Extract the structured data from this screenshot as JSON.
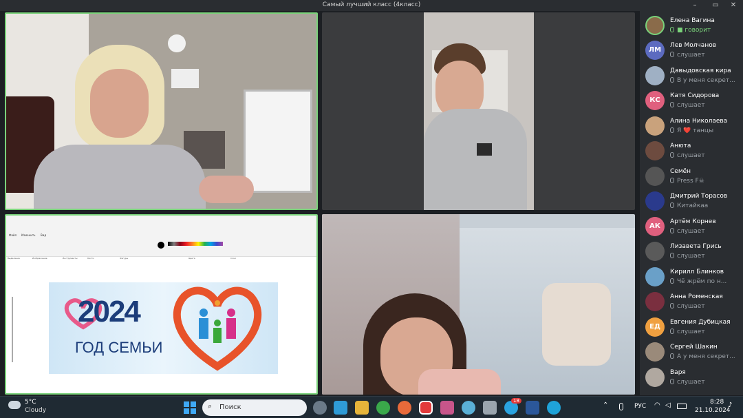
{
  "window": {
    "title": "Самый лучший класс (4класс)",
    "minimize": "–",
    "maximize": "▭",
    "close": "✕"
  },
  "paint": {
    "menu_file": "Файл",
    "menu_edit": "Изменить",
    "menu_view": "Вид",
    "year": "2024",
    "slogan": "ГОД СЕМЬИ",
    "groups": [
      "Выделение",
      "Изображение",
      "Инструменты",
      "Кисти",
      "Фигуры",
      "Цвета",
      "Слои"
    ]
  },
  "participants": [
    {
      "name": "Елена Вагина",
      "status": "говорит",
      "initials": "",
      "color": "#8a6b4a",
      "speaking": true
    },
    {
      "name": "Лев Молчанов",
      "status": "слушает",
      "initials": "ЛМ",
      "color": "#5c6bc0"
    },
    {
      "name": "Давыдовская кира",
      "status": "В у меня секрет...",
      "initials": "",
      "color": "#9fb0c4"
    },
    {
      "name": "Катя Сидорова",
      "status": "слушает",
      "initials": "КС",
      "color": "#e0607e"
    },
    {
      "name": "Алина Николаева",
      "status": "Я ❤️ танцы",
      "initials": "",
      "color": "#c9a27c"
    },
    {
      "name": "Анюта",
      "status": "слушает",
      "initials": "",
      "color": "#6d4b3f"
    },
    {
      "name": "Семён",
      "status": "Press F☠",
      "initials": "",
      "color": "#555"
    },
    {
      "name": "Дмитрий Торасов",
      "status": "Китайкаа",
      "initials": "",
      "color": "#2a3a8c"
    },
    {
      "name": "Артём Корнев",
      "status": "слушает",
      "initials": "АК",
      "color": "#e0607e"
    },
    {
      "name": "Лизавета Грись",
      "status": "слушает",
      "initials": "",
      "color": "#5a5a5a"
    },
    {
      "name": "Кирилл Блинков",
      "status": "Чё жрём по н...",
      "initials": "",
      "color": "#6aa0c8"
    },
    {
      "name": "Анна Роменская",
      "status": "слушает",
      "initials": "",
      "color": "#7a2f3f"
    },
    {
      "name": "Евгения Дубицкая",
      "status": "слушает",
      "initials": "ЕД",
      "color": "#f0a040"
    },
    {
      "name": "Сергей Шакин",
      "status": "А у меня секрет...",
      "initials": "",
      "color": "#9a8a7a"
    },
    {
      "name": "Варя",
      "status": "слушает",
      "initials": "",
      "color": "#b0a8a0"
    }
  ],
  "taskbar": {
    "weather_temp": "5°C",
    "weather_desc": "Cloudy",
    "search_placeholder": "Поиск",
    "lang": "РУС",
    "time": "8:28",
    "date": "21.10.2024",
    "telegram_badge": "18"
  }
}
